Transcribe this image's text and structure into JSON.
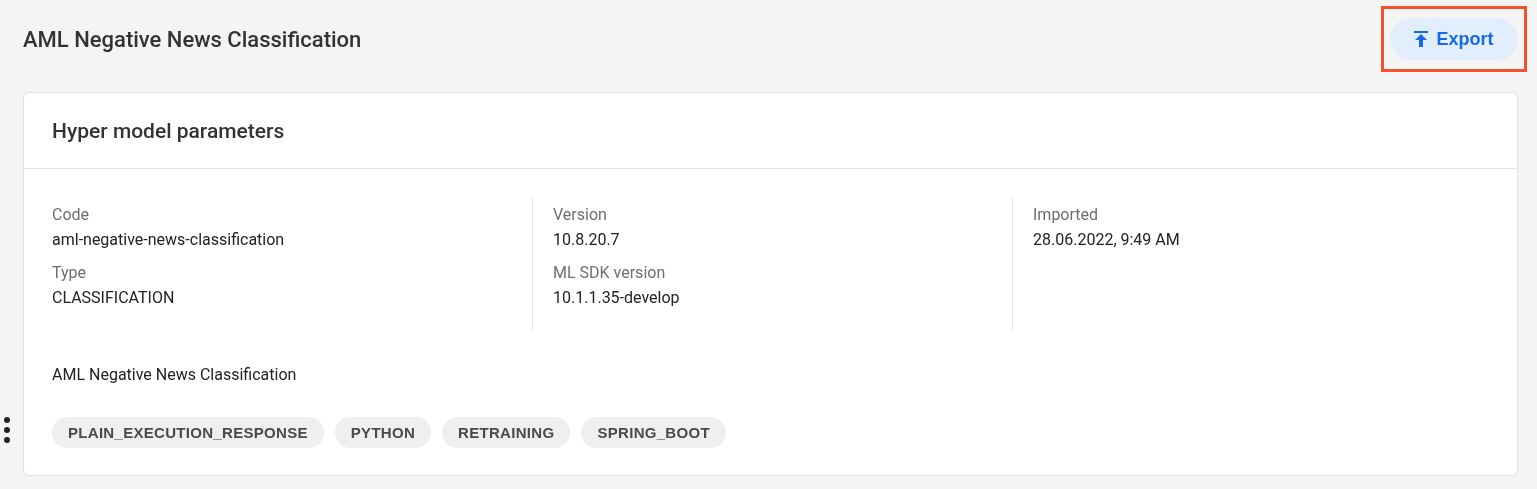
{
  "page": {
    "title": "AML Negative News Classification"
  },
  "export_button": {
    "label": "Export",
    "highlighted": true
  },
  "card": {
    "title": "Hyper model parameters",
    "columns": [
      {
        "fields": [
          {
            "label": "Code",
            "value": "aml-negative-news-classification"
          },
          {
            "label": "Type",
            "value": "CLASSIFICATION"
          }
        ]
      },
      {
        "fields": [
          {
            "label": "Version",
            "value": "10.8.20.7"
          },
          {
            "label": "ML SDK version",
            "value": "10.1.1.35-develop"
          }
        ]
      },
      {
        "fields": [
          {
            "label": "Imported",
            "value": "28.06.2022, 9:49 AM"
          }
        ]
      }
    ],
    "description": "AML Negative News Classification",
    "tags": [
      "PLAIN_EXECUTION_RESPONSE",
      "PYTHON",
      "RETRAINING",
      "SPRING_BOOT"
    ]
  }
}
